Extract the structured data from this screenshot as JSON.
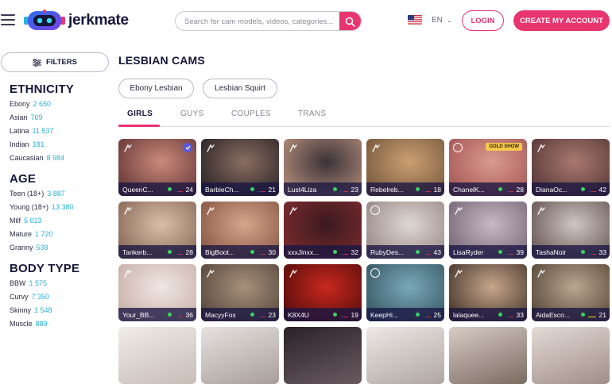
{
  "header": {
    "logo_text": "jerkmate",
    "search_placeholder": "Search for cam models, videos, categories...",
    "language": "EN",
    "login_label": "LOGIN",
    "create_account_label": "CREATE MY ACCOUNT",
    "accent_color": "#e8356f"
  },
  "sidebar": {
    "filters_label": "FILTERS",
    "sections": [
      {
        "heading": "ETHNICITY",
        "items": [
          {
            "label": "Ebony",
            "count": "2 650"
          },
          {
            "label": "Asian",
            "count": "769"
          },
          {
            "label": "Latina",
            "count": "11 537"
          },
          {
            "label": "Indian",
            "count": "181"
          },
          {
            "label": "Caucasian",
            "count": "8 984"
          }
        ]
      },
      {
        "heading": "AGE",
        "items": [
          {
            "label": "Teen (18+)",
            "count": "3 887"
          },
          {
            "label": "Young (18+)",
            "count": "13 380"
          },
          {
            "label": "Milf",
            "count": "5 013"
          },
          {
            "label": "Mature",
            "count": "1 720"
          },
          {
            "label": "Granny",
            "count": "538"
          }
        ]
      },
      {
        "heading": "BODY TYPE",
        "items": [
          {
            "label": "BBW",
            "count": "1 575"
          },
          {
            "label": "Curvy",
            "count": "7 350"
          },
          {
            "label": "Skinny",
            "count": "1 548"
          },
          {
            "label": "Muscle",
            "count": "889"
          }
        ]
      }
    ]
  },
  "main": {
    "title": "LESBIAN CAMS",
    "chips": [
      "Ebony Lesbian",
      "Lesbian Squirt"
    ],
    "tabs": [
      "GIRLS",
      "GUYS",
      "COUPLES",
      "TRANS"
    ],
    "active_tab": "GIRLS",
    "models": [
      {
        "name": "QueenC...",
        "age": "24",
        "flag": "us",
        "icon": "vr",
        "extra": "verified",
        "bg": [
          "#c98a7a",
          "#6b3a3a"
        ]
      },
      {
        "name": "BarbieCh...",
        "age": "21",
        "flag": "us",
        "icon": "vr",
        "bg": [
          "#8a6e62",
          "#2e2628"
        ]
      },
      {
        "name": "Lust4Liza",
        "age": "23",
        "flag": "us",
        "icon": "vr",
        "bg": [
          "#3a3238",
          "#b08a78"
        ]
      },
      {
        "name": "Rebelreb...",
        "age": "18",
        "flag": "us",
        "icon": "vr",
        "bg": [
          "#c9a072",
          "#7a5a3e"
        ]
      },
      {
        "name": "ChanelK...",
        "age": "28",
        "flag": "us",
        "icon": "ring",
        "extra": "GOLD SHOW",
        "bg": [
          "#d99a8e",
          "#a85a58"
        ]
      },
      {
        "name": "DianaOc...",
        "age": "42",
        "flag": "us",
        "icon": "vr",
        "bg": [
          "#a87a6e",
          "#5a3a3a"
        ]
      },
      {
        "name": "Tankerb...",
        "age": "28",
        "flag": "us",
        "icon": "vr",
        "bg": [
          "#d8c0a8",
          "#8a6a5a"
        ]
      },
      {
        "name": "BigBoot...",
        "age": "30",
        "flag": "us",
        "icon": "vr",
        "bg": [
          "#d6a58a",
          "#8a5a48"
        ]
      },
      {
        "name": "xxxJinxx...",
        "age": "32",
        "flag": "us",
        "icon": "vr",
        "bg": [
          "#3a1a1e",
          "#7a2a2e"
        ]
      },
      {
        "name": "RubyDes...",
        "age": "43",
        "flag": "us",
        "icon": "ring",
        "bg": [
          "#e0d8d4",
          "#9a8a88"
        ]
      },
      {
        "name": "LisaRyder",
        "age": "39",
        "flag": "us",
        "icon": "vr",
        "bg": [
          "#c8b8c2",
          "#7a6a7a"
        ]
      },
      {
        "name": "TashaNoir",
        "age": "33",
        "flag": "us",
        "icon": "vr",
        "bg": [
          "#d0c6c0",
          "#6a5a58"
        ]
      },
      {
        "name": "Your_BB...",
        "age": "36",
        "flag": "us",
        "icon": "vr",
        "bg": [
          "#f0e6e2",
          "#c8b2aa"
        ]
      },
      {
        "name": "MacyyFox",
        "age": "23",
        "flag": "us",
        "icon": "vr",
        "bg": [
          "#a8907a",
          "#5a4a3e"
        ]
      },
      {
        "name": "K8X4U",
        "age": "19",
        "flag": "us",
        "icon": "vr",
        "bg": [
          "#c8281e",
          "#5a0e0c"
        ]
      },
      {
        "name": "KeepHi...",
        "age": "25",
        "flag": "us",
        "icon": "ring",
        "bg": [
          "#7aa8b8",
          "#3a5a68"
        ]
      },
      {
        "name": "lalaquee...",
        "age": "33",
        "flag": "us",
        "icon": "vr",
        "bg": [
          "#c8a68a",
          "#4a3a30"
        ]
      },
      {
        "name": "AidaEsco...",
        "age": "21",
        "flag": "co",
        "icon": "vr",
        "bg": [
          "#b8a890",
          "#5a4a3a"
        ]
      }
    ]
  }
}
